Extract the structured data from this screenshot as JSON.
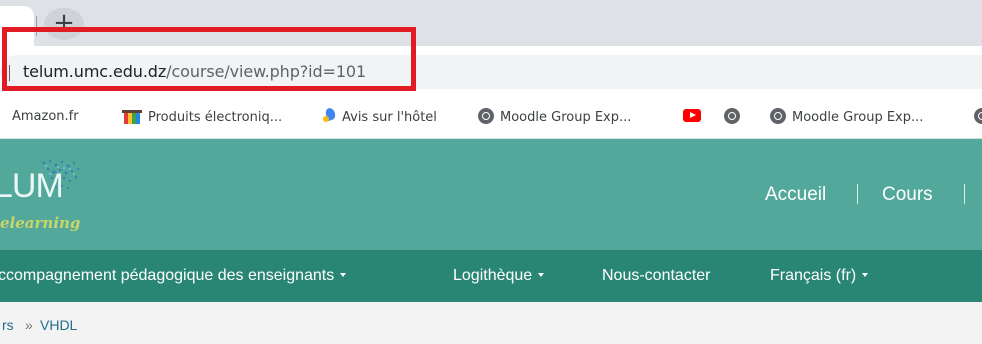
{
  "browser": {
    "tab": {
      "close_glyph": "×"
    },
    "new_tab_glyph": "+",
    "url": {
      "domain": "telum.umc.edu.dz",
      "path": "/course/view.php?id=101"
    },
    "bookmarks": [
      {
        "label": "Amazon.fr",
        "icon": "none"
      },
      {
        "label": "Produits électroniq...",
        "icon": "shopping-icon"
      },
      {
        "label": "Avis sur l'hôtel",
        "icon": "pin-icon"
      },
      {
        "label": "Moodle Group Exp...",
        "icon": "globe-icon"
      },
      {
        "label": "",
        "icon": "youtube-icon"
      },
      {
        "label": "",
        "icon": "globe-icon"
      },
      {
        "label": "Moodle Group Exp...",
        "icon": "globe-icon"
      },
      {
        "label": "",
        "icon": "globe-icon"
      }
    ]
  },
  "site": {
    "logo_text": "LUM",
    "logo_tagline": "elearning",
    "header_nav": [
      {
        "label": "Accueil"
      },
      {
        "label": "Cours"
      }
    ],
    "menu": [
      {
        "label": "ccompagnement pédagogique des enseignants",
        "has_dropdown": true
      },
      {
        "label": "Logithèque",
        "has_dropdown": true
      },
      {
        "label": "Nous-contacter",
        "has_dropdown": false
      },
      {
        "label": "Français ‎(fr)‎",
        "has_dropdown": true
      }
    ],
    "breadcrumb": {
      "items": [
        "rs",
        "VHDL"
      ],
      "separator": "»"
    }
  },
  "colors": {
    "header_bg": "#52a99b",
    "menu_bg": "#2a8674",
    "highlight": "#e01b24"
  }
}
